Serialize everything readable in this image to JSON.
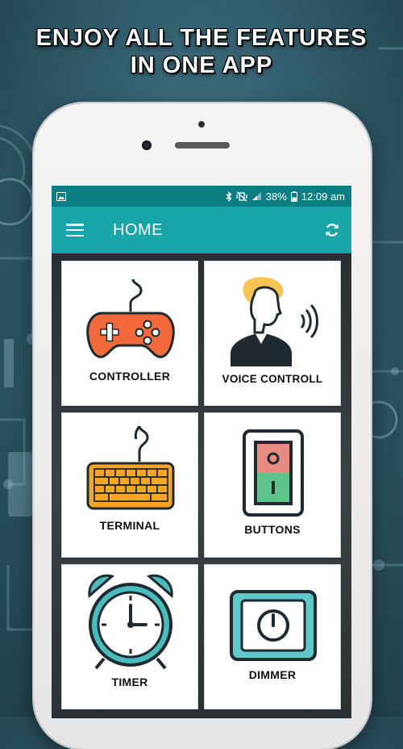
{
  "promo": {
    "line1": "ENJOY ALL  THE FEATURES",
    "line2": "IN ONE APP"
  },
  "statusbar": {
    "battery": "38%",
    "time": "12:09 am",
    "icons": [
      "image-notification-icon",
      "bluetooth-icon",
      "vibrate-off-icon",
      "signal-icon",
      "battery-icon"
    ]
  },
  "appbar": {
    "title": "HOME",
    "menu_icon": "hamburger-menu-icon",
    "action_icon": "refresh-icon"
  },
  "tiles": [
    {
      "label": "CONTROLLER",
      "icon": "gamepad-icon"
    },
    {
      "label": "VOICE CONTROLL",
      "icon": "voice-control-icon"
    },
    {
      "label": "TERMINAL",
      "icon": "keyboard-icon"
    },
    {
      "label": "BUTTONS",
      "icon": "switch-buttons-icon"
    },
    {
      "label": "TIMER",
      "icon": "alarm-clock-icon"
    },
    {
      "label": "DIMMER",
      "icon": "dimmer-icon"
    }
  ],
  "colors": {
    "statusbar": "#0d7e83",
    "appbar": "#19a4a7",
    "controller": "#f26a3c",
    "keyboard": "#f6a623",
    "switch_top": "#e88a7f",
    "switch_bottom": "#5fc38a",
    "timer": "#49bcbc",
    "dimmer": "#5fc8c8"
  }
}
